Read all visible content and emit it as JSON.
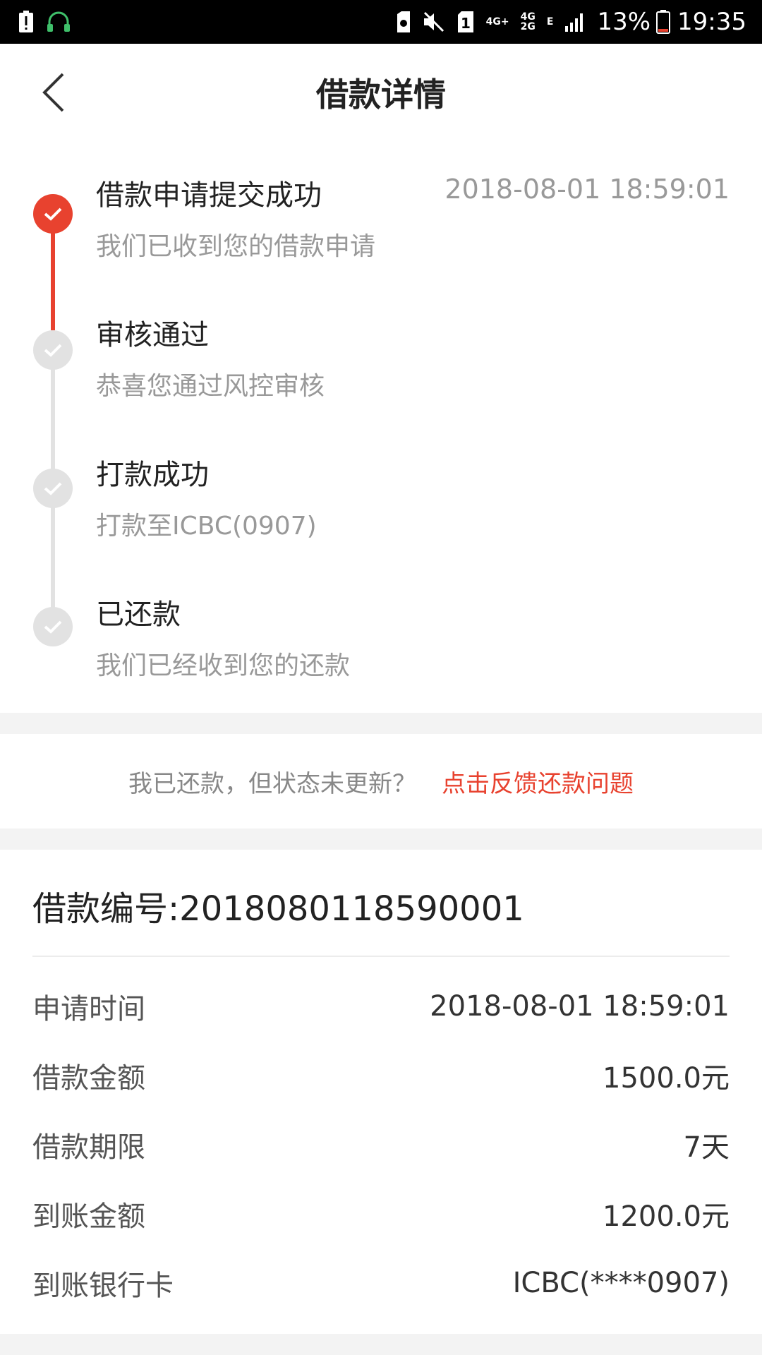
{
  "status_bar": {
    "battery_percent": "13%",
    "time": "19:35",
    "network_1": "4G+",
    "network_2": "4G",
    "network_3": "2G",
    "network_e": "E",
    "sim_label": "1",
    "icons_left": [
      "alert-icon",
      "headset-icon"
    ],
    "icons_right": [
      "sim-icon",
      "mute-icon",
      "sim-1-icon",
      "signal-icon",
      "battery-icon"
    ]
  },
  "header": {
    "title": "借款详情"
  },
  "timeline": {
    "steps": [
      {
        "title": "借款申请提交成功",
        "desc": "我们已收到您的借款申请",
        "time": "2018-08-01 18:59:01",
        "state": "active"
      },
      {
        "title": "审核通过",
        "desc": "恭喜您通过风控审核",
        "time": "",
        "state": "inactive"
      },
      {
        "title": "打款成功",
        "desc": "打款至ICBC(0907)",
        "time": "",
        "state": "inactive"
      },
      {
        "title": "已还款",
        "desc": "我们已经收到您的还款",
        "time": "",
        "state": "inactive"
      }
    ]
  },
  "feedback": {
    "text": "我已还款，但状态未更新？",
    "link": "点击反馈还款问题"
  },
  "details": {
    "loan_number": "借款编号:2018080118590001",
    "rows": [
      {
        "label": "申请时间",
        "value": "2018-08-01 18:59:01"
      },
      {
        "label": "借款金额",
        "value": "1500.0元"
      },
      {
        "label": "借款期限",
        "value": "7天"
      },
      {
        "label": "到账金额",
        "value": "1200.0元"
      },
      {
        "label": "到账银行卡",
        "value": "ICBC(****0907)"
      }
    ]
  },
  "colors": {
    "accent": "#e8422f",
    "inactive": "#e2e2e2",
    "text_primary": "#222222",
    "text_secondary": "#999999"
  }
}
